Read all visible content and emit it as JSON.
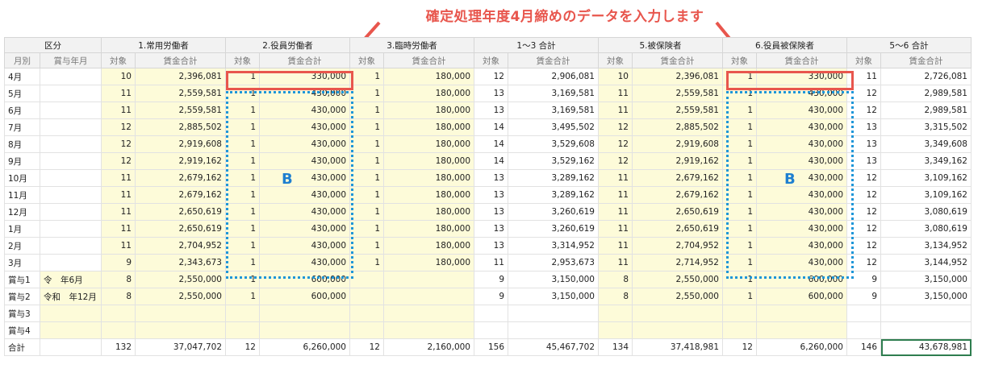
{
  "annotation": {
    "title": "確定処理年度4月締めのデータを入力します",
    "b_label_left": "B",
    "b_label_right": "B"
  },
  "header": {
    "group1": [
      "区分",
      "1.常用労働者",
      "2.役員労働者",
      "3.臨時労働者",
      "1〜3 合計",
      "5.被保険者",
      "6.役員被保険者",
      "5〜6 合計"
    ],
    "col_month": "月別",
    "col_bonus_month": "賞与年月",
    "col_count": "対象",
    "col_wage": "賃金合計"
  },
  "rows": [
    {
      "m": "4月",
      "bym": "",
      "c1": "10",
      "w1": "2,396,081",
      "c2": "1",
      "w2": "330,000",
      "c3": "1",
      "w3": "180,000",
      "c4": "12",
      "w4": "2,906,081",
      "c5": "10",
      "w5": "2,396,081",
      "c6": "1",
      "w6": "330,000",
      "c7": "11",
      "w7": "2,726,081"
    },
    {
      "m": "5月",
      "bym": "",
      "c1": "11",
      "w1": "2,559,581",
      "c2": "1",
      "w2": "430,000",
      "c3": "1",
      "w3": "180,000",
      "c4": "13",
      "w4": "3,169,581",
      "c5": "11",
      "w5": "2,559,581",
      "c6": "1",
      "w6": "430,000",
      "c7": "12",
      "w7": "2,989,581"
    },
    {
      "m": "6月",
      "bym": "",
      "c1": "11",
      "w1": "2,559,581",
      "c2": "1",
      "w2": "430,000",
      "c3": "1",
      "w3": "180,000",
      "c4": "13",
      "w4": "3,169,581",
      "c5": "11",
      "w5": "2,559,581",
      "c6": "1",
      "w6": "430,000",
      "c7": "12",
      "w7": "2,989,581"
    },
    {
      "m": "7月",
      "bym": "",
      "c1": "12",
      "w1": "2,885,502",
      "c2": "1",
      "w2": "430,000",
      "c3": "1",
      "w3": "180,000",
      "c4": "14",
      "w4": "3,495,502",
      "c5": "12",
      "w5": "2,885,502",
      "c6": "1",
      "w6": "430,000",
      "c7": "13",
      "w7": "3,315,502"
    },
    {
      "m": "8月",
      "bym": "",
      "c1": "12",
      "w1": "2,919,608",
      "c2": "1",
      "w2": "430,000",
      "c3": "1",
      "w3": "180,000",
      "c4": "14",
      "w4": "3,529,608",
      "c5": "12",
      "w5": "2,919,608",
      "c6": "1",
      "w6": "430,000",
      "c7": "13",
      "w7": "3,349,608"
    },
    {
      "m": "9月",
      "bym": "",
      "c1": "12",
      "w1": "2,919,162",
      "c2": "1",
      "w2": "430,000",
      "c3": "1",
      "w3": "180,000",
      "c4": "14",
      "w4": "3,529,162",
      "c5": "12",
      "w5": "2,919,162",
      "c6": "1",
      "w6": "430,000",
      "c7": "13",
      "w7": "3,349,162"
    },
    {
      "m": "10月",
      "bym": "",
      "c1": "11",
      "w1": "2,679,162",
      "c2": "1",
      "w2": "430,000",
      "c3": "1",
      "w3": "180,000",
      "c4": "13",
      "w4": "3,289,162",
      "c5": "11",
      "w5": "2,679,162",
      "c6": "1",
      "w6": "430,000",
      "c7": "12",
      "w7": "3,109,162"
    },
    {
      "m": "11月",
      "bym": "",
      "c1": "11",
      "w1": "2,679,162",
      "c2": "1",
      "w2": "430,000",
      "c3": "1",
      "w3": "180,000",
      "c4": "13",
      "w4": "3,289,162",
      "c5": "11",
      "w5": "2,679,162",
      "c6": "1",
      "w6": "430,000",
      "c7": "12",
      "w7": "3,109,162"
    },
    {
      "m": "12月",
      "bym": "",
      "c1": "11",
      "w1": "2,650,619",
      "c2": "1",
      "w2": "430,000",
      "c3": "1",
      "w3": "180,000",
      "c4": "13",
      "w4": "3,260,619",
      "c5": "11",
      "w5": "2,650,619",
      "c6": "1",
      "w6": "430,000",
      "c7": "12",
      "w7": "3,080,619"
    },
    {
      "m": "1月",
      "bym": "",
      "c1": "11",
      "w1": "2,650,619",
      "c2": "1",
      "w2": "430,000",
      "c3": "1",
      "w3": "180,000",
      "c4": "13",
      "w4": "3,260,619",
      "c5": "11",
      "w5": "2,650,619",
      "c6": "1",
      "w6": "430,000",
      "c7": "12",
      "w7": "3,080,619"
    },
    {
      "m": "2月",
      "bym": "",
      "c1": "11",
      "w1": "2,704,952",
      "c2": "1",
      "w2": "430,000",
      "c3": "1",
      "w3": "180,000",
      "c4": "13",
      "w4": "3,314,952",
      "c5": "11",
      "w5": "2,704,952",
      "c6": "1",
      "w6": "430,000",
      "c7": "12",
      "w7": "3,134,952"
    },
    {
      "m": "3月",
      "bym": "",
      "c1": "9",
      "w1": "2,343,673",
      "c2": "1",
      "w2": "430,000",
      "c3": "1",
      "w3": "180,000",
      "c4": "11",
      "w4": "2,953,673",
      "c5": "11",
      "w5": "2,714,952",
      "c6": "1",
      "w6": "430,000",
      "c7": "12",
      "w7": "3,144,952"
    },
    {
      "m": "賞与1",
      "bym": "令　年6月",
      "c1": "8",
      "w1": "2,550,000",
      "c2": "1",
      "w2": "600,000",
      "c3": "",
      "w3": "",
      "c4": "9",
      "w4": "3,150,000",
      "c5": "8",
      "w5": "2,550,000",
      "c6": "1",
      "w6": "600,000",
      "c7": "9",
      "w7": "3,150,000"
    },
    {
      "m": "賞与2",
      "bym": "令和　年12月",
      "c1": "8",
      "w1": "2,550,000",
      "c2": "1",
      "w2": "600,000",
      "c3": "",
      "w3": "",
      "c4": "9",
      "w4": "3,150,000",
      "c5": "8",
      "w5": "2,550,000",
      "c6": "1",
      "w6": "600,000",
      "c7": "9",
      "w7": "3,150,000"
    },
    {
      "m": "賞与3",
      "bym": "",
      "c1": "",
      "w1": "",
      "c2": "",
      "w2": "",
      "c3": "",
      "w3": "",
      "c4": "",
      "w4": "",
      "c5": "",
      "w5": "",
      "c6": "",
      "w6": "",
      "c7": "",
      "w7": ""
    },
    {
      "m": "賞与4",
      "bym": "",
      "c1": "",
      "w1": "",
      "c2": "",
      "w2": "",
      "c3": "",
      "w3": "",
      "c4": "",
      "w4": "",
      "c5": "",
      "w5": "",
      "c6": "",
      "w6": "",
      "c7": "",
      "w7": ""
    },
    {
      "m": "合計",
      "bym": "",
      "c1": "132",
      "w1": "37,047,702",
      "c2": "12",
      "w2": "6,260,000",
      "c3": "12",
      "w3": "2,160,000",
      "c4": "156",
      "w4": "45,467,702",
      "c5": "134",
      "w5": "37,418,981",
      "c6": "12",
      "w6": "6,260,000",
      "c7": "146",
      "w7": "43,678,981"
    }
  ]
}
